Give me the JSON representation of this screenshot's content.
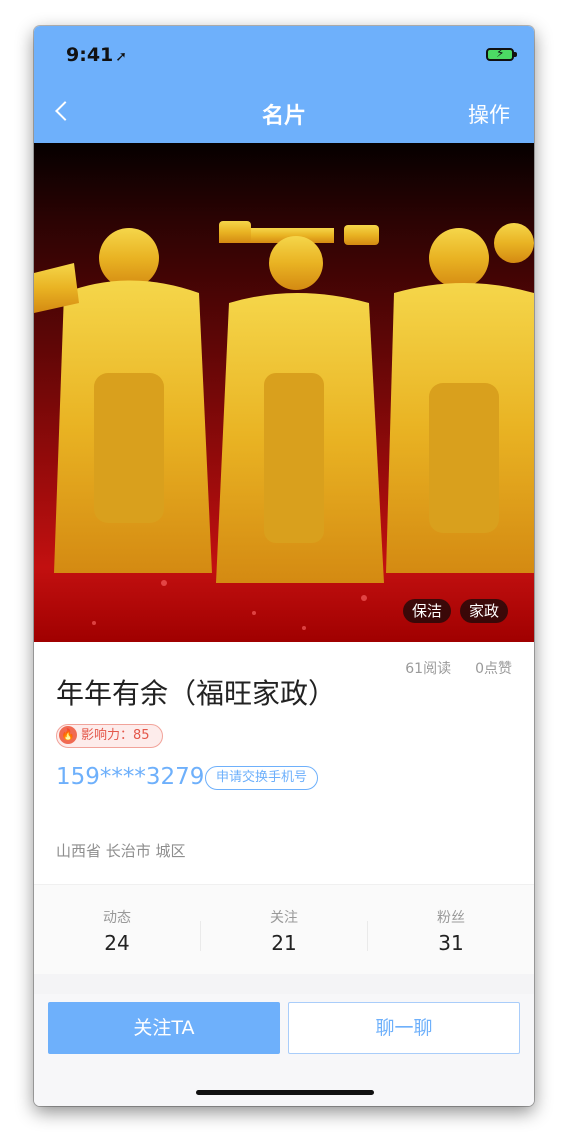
{
  "status_bar": {
    "time": "9:41"
  },
  "nav": {
    "title": "名片",
    "action_label": "操作"
  },
  "hero": {
    "tags": [
      "保洁",
      "家政"
    ]
  },
  "profile": {
    "reads": "61阅读",
    "likes": "0点赞",
    "name": "年年有余（福旺家政）",
    "influence": "影响力：85",
    "phone": "159****3279",
    "exchange_label": "申请交换手机号",
    "location": "山西省 长治市 城区"
  },
  "counters": [
    {
      "label": "动态",
      "value": "24"
    },
    {
      "label": "关注",
      "value": "21"
    },
    {
      "label": "粉丝",
      "value": "31"
    }
  ],
  "actions": {
    "follow_label": "关注TA",
    "chat_label": "聊一聊"
  },
  "colors": {
    "accent": "#6eb0fb",
    "hero_red": "#c21010",
    "gold": "#e8b825"
  }
}
